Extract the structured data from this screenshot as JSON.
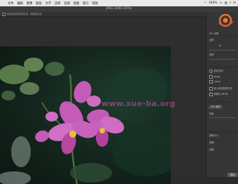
{
  "menubar": {
    "items": [
      "文件",
      "编辑",
      "图像",
      "图层",
      "文字",
      "选择",
      "滤镜",
      "视图",
      "窗口",
      "帮助"
    ],
    "battery": "100%",
    "clock": "周"
  },
  "window": {
    "title": "JPEG 3000 (25%)"
  },
  "optbar": {
    "option1": "选择连续像素的区域",
    "option2": "调整颜色后"
  },
  "watermark": "www.xue-ba.org",
  "panel": {
    "section1": "JPG 设置",
    "row1": "品质",
    "row2": "大",
    "row3": "品质",
    "section2": "色彩空间",
    "chk1": "sRGB",
    "chk2": "CMYK",
    "chk3": "嵌入颜色配置文件",
    "chk4": "转换为 sRGB",
    "section3": "JPG 选项",
    "row4": "背景",
    "section4": "图像大小",
    "row5": "宽度",
    "row6": "高度",
    "corner_button": "导出"
  },
  "colors": {
    "accent": "#e8742a",
    "petal": "#c45bb8",
    "background": "#2b2b2b"
  }
}
